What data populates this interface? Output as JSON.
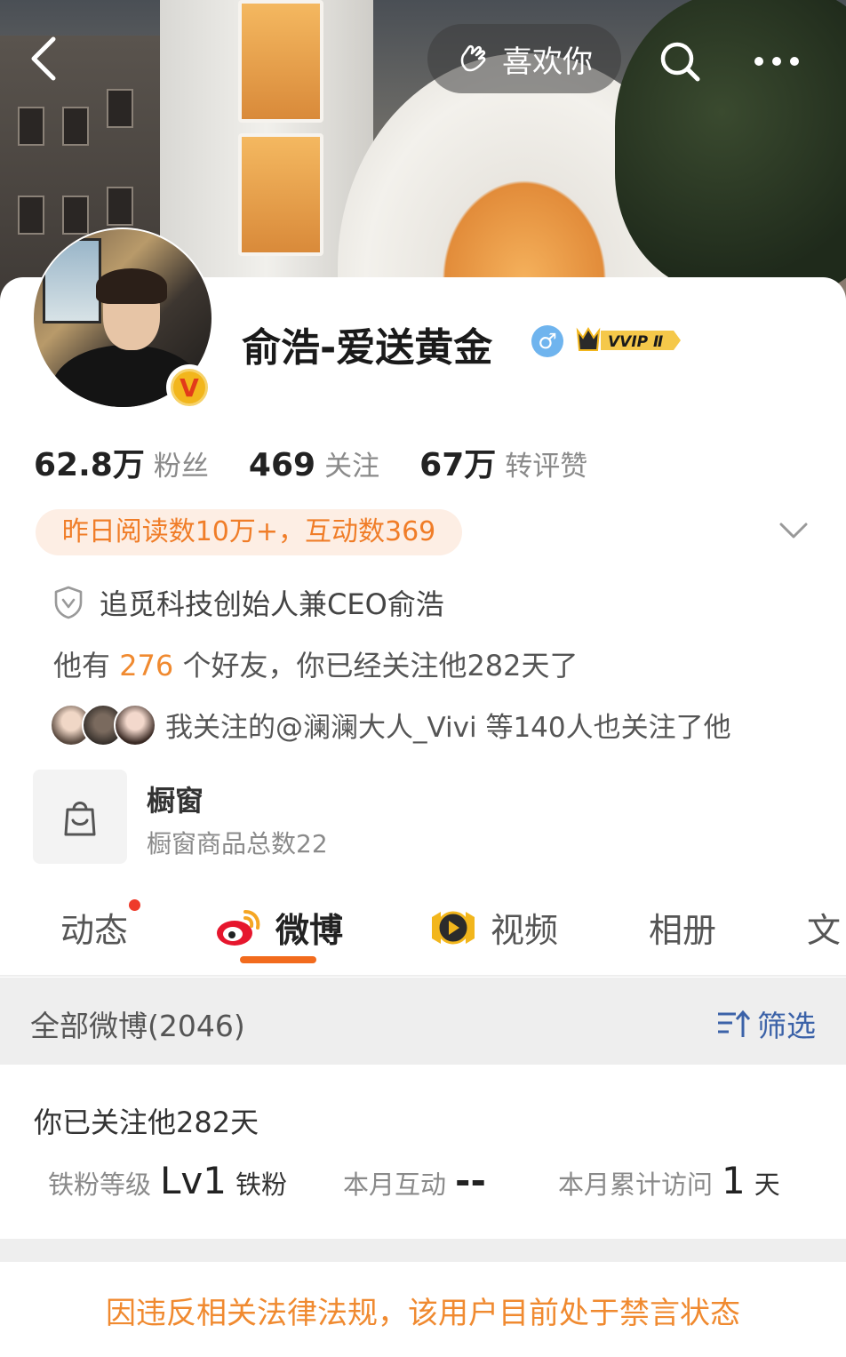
{
  "header": {
    "like_label": "喜欢你",
    "icons": [
      "back-icon",
      "like-hand-icon",
      "search-icon",
      "more-icon"
    ]
  },
  "profile": {
    "name": "俞浩-爱送黄金",
    "gender_symbol": "♂",
    "verified_badge": "V",
    "vip_label": "VVIP Ⅱ"
  },
  "stats": [
    {
      "num": "62.8万",
      "label": "粉丝"
    },
    {
      "num": "469",
      "label": "关注"
    },
    {
      "num": "67万",
      "label": "转评赞"
    }
  ],
  "highlight": "昨日阅读数10万+，互动数369",
  "verification": "追觅科技创始人兼CEO俞浩",
  "friends": {
    "prefix": "他有 ",
    "count": "276",
    "suffix": " 个好友，你已经关注他282天了"
  },
  "mutual": "我关注的@澜澜大人_Vivi 等140人也关注了他",
  "shop": {
    "title": "橱窗",
    "subtitle": "橱窗商品总数22"
  },
  "tabs": [
    {
      "label": "动态"
    },
    {
      "label": "微博"
    },
    {
      "label": "视频"
    },
    {
      "label": "相册"
    },
    {
      "label": "文"
    }
  ],
  "filter": {
    "all_label": "全部微博(2046)",
    "filter_label": "筛选"
  },
  "fan_card": {
    "heading": "你已关注他282天",
    "level_label": "铁粉等级",
    "level_value": "Lv1",
    "level_unit": "铁粉",
    "interact_label": "本月互动",
    "interact_value": "--",
    "visit_label": "本月累计访问",
    "visit_value": "1",
    "visit_unit": "天"
  },
  "ban_notice": "因违反相关法律法规，该用户目前处于禁言状态",
  "colors": {
    "accent_orange": "#f26b1d",
    "highlight_text": "#f07d28",
    "filter_blue": "#3b62a8",
    "gender_blue": "#6fb4ee",
    "notification_red": "#ee3a2a"
  }
}
